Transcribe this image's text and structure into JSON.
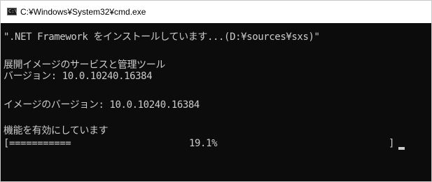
{
  "window": {
    "title": "C:¥Windows¥System32¥cmd.exe",
    "icon": "cmd-prompt-icon"
  },
  "console": {
    "lines": [
      "\".NET Framework をインストールしています...(D:¥sources¥sxs)\"",
      "展開イメージのサービスと管理ツール",
      "バージョン: 10.0.10240.16384",
      "イメージのバージョン: 10.0.10240.16384",
      "機能を有効にしています"
    ],
    "progress": {
      "bracket_open": "[",
      "bar": "===========",
      "percent_text": "19.1%",
      "value": 19.1,
      "bracket_close": "]"
    }
  },
  "colors": {
    "console_background": "#0c0c0c",
    "console_text": "#cccccc",
    "titlebar_background": "#ffffff"
  }
}
